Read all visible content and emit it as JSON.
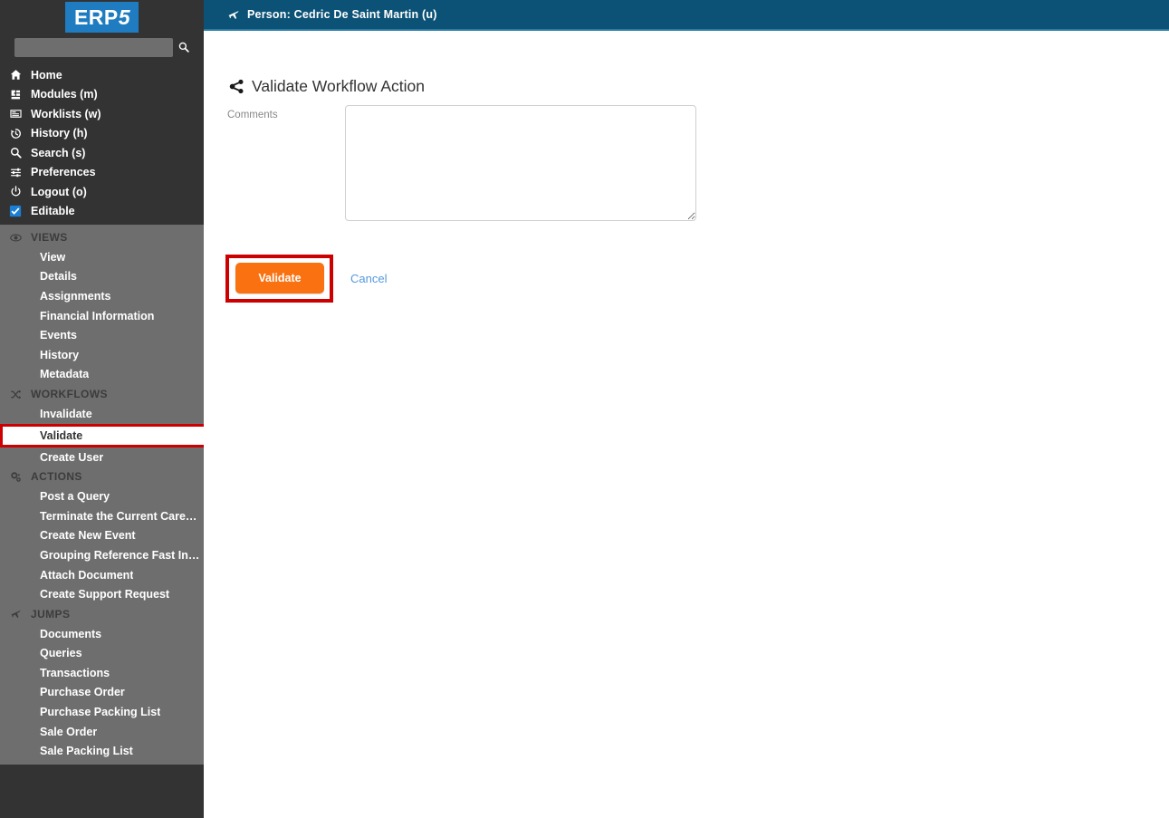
{
  "brand": {
    "name_prefix": "ERP",
    "name_suffix": "5",
    "logo_bg": "#1f7cc0"
  },
  "search": {
    "value": "",
    "placeholder": "",
    "icon": "search-icon"
  },
  "sidebar": {
    "top_items": [
      {
        "label": "Home",
        "icon": "home-icon"
      },
      {
        "label": "Modules (m)",
        "icon": "modules-icon"
      },
      {
        "label": "Worklists (w)",
        "icon": "worklists-icon"
      },
      {
        "label": "History (h)",
        "icon": "history-icon"
      },
      {
        "label": "Search (s)",
        "icon": "search-icon"
      },
      {
        "label": "Preferences",
        "icon": "preferences-icon"
      },
      {
        "label": "Logout (o)",
        "icon": "logout-icon"
      },
      {
        "label": "Editable",
        "icon": "checkbox-checked-icon"
      }
    ],
    "sections": [
      {
        "title": "VIEWS",
        "icon": "eye-icon",
        "items": [
          {
            "label": "View",
            "selected": false
          },
          {
            "label": "Details",
            "selected": false
          },
          {
            "label": "Assignments",
            "selected": false
          },
          {
            "label": "Financial Information",
            "selected": false
          },
          {
            "label": "Events",
            "selected": false
          },
          {
            "label": "History",
            "selected": false
          },
          {
            "label": "Metadata",
            "selected": false
          }
        ]
      },
      {
        "title": "WORKFLOWS",
        "icon": "shuffle-icon",
        "items": [
          {
            "label": "Invalidate",
            "selected": false
          },
          {
            "label": "Validate",
            "selected": true
          },
          {
            "label": "Create User",
            "selected": false
          }
        ]
      },
      {
        "title": "ACTIONS",
        "icon": "gears-icon",
        "items": [
          {
            "label": "Post a Query",
            "selected": false
          },
          {
            "label": "Terminate the Current Career...",
            "selected": false
          },
          {
            "label": "Create New Event",
            "selected": false
          },
          {
            "label": "Grouping Reference Fast Input",
            "selected": false
          },
          {
            "label": "Attach Document",
            "selected": false
          },
          {
            "label": "Create Support Request",
            "selected": false
          }
        ]
      },
      {
        "title": "JUMPS",
        "icon": "plane-icon",
        "items": [
          {
            "label": "Documents",
            "selected": false
          },
          {
            "label": "Queries",
            "selected": false
          },
          {
            "label": "Transactions",
            "selected": false
          },
          {
            "label": "Purchase Order",
            "selected": false
          },
          {
            "label": "Purchase Packing List",
            "selected": false
          },
          {
            "label": "Sale Order",
            "selected": false
          },
          {
            "label": "Sale Packing List",
            "selected": false
          }
        ]
      }
    ]
  },
  "header": {
    "icon": "plane-icon",
    "title": "Person: Cedric De Saint Martin (u)",
    "bg": "#0b5276"
  },
  "main": {
    "title_icon": "share-nodes-icon",
    "title": "Validate Workflow Action",
    "comments_label": "Comments",
    "comments_value": "",
    "comments_placeholder": "",
    "validate_label": "Validate",
    "cancel_label": "Cancel",
    "accent_orange": "#f97110",
    "highlight_red": "#cc0000",
    "link_blue": "#5599dd"
  }
}
